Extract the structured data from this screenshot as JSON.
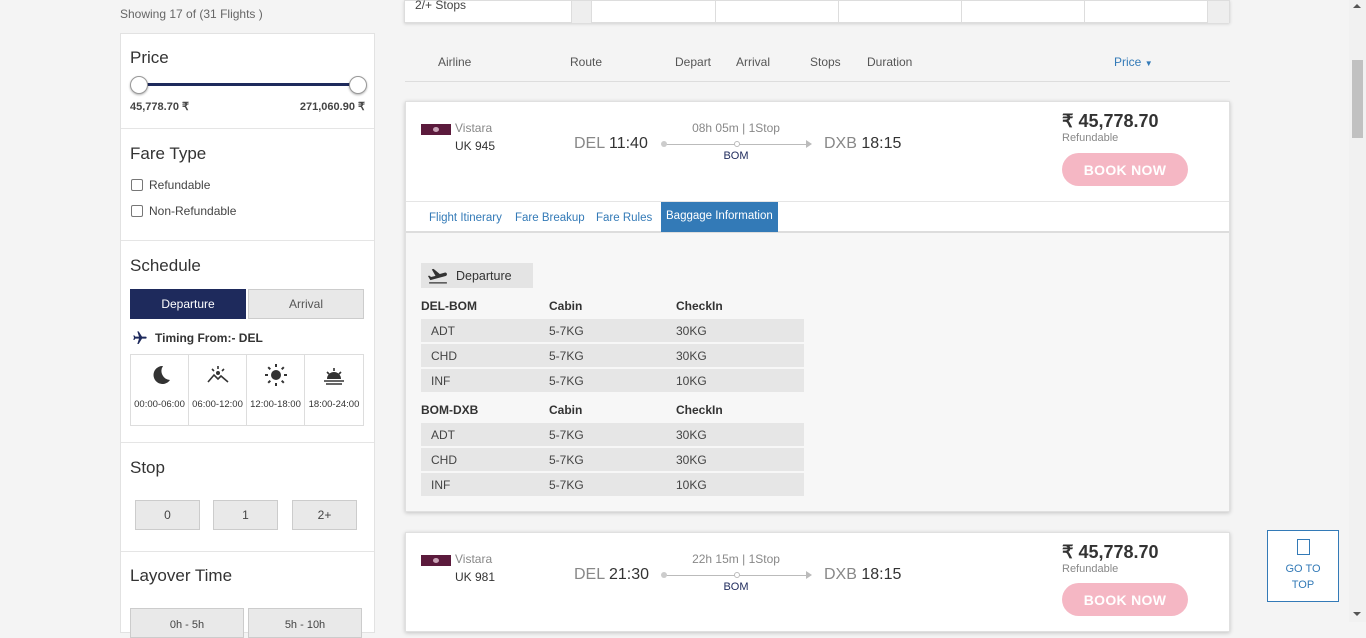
{
  "results": {
    "showing": "Showing 17 of (31 Flights )"
  },
  "top_strip": {
    "label": "2/+ Stops"
  },
  "filters": {
    "price": {
      "title": "Price",
      "min": "45,778.70 ₹",
      "max": "271,060.90 ₹"
    },
    "fare_type": {
      "title": "Fare Type",
      "options": [
        "Refundable",
        "Non-Refundable"
      ]
    },
    "schedule": {
      "title": "Schedule",
      "tabs": [
        "Departure",
        "Arrival"
      ],
      "timing": "Timing From:- DEL",
      "slots": [
        "00:00-06:00",
        "06:00-12:00",
        "12:00-18:00",
        "18:00-24:00"
      ]
    },
    "stop": {
      "title": "Stop",
      "options": [
        "0",
        "1",
        "2+"
      ]
    },
    "layover": {
      "title": "Layover Time",
      "options": [
        "0h - 5h",
        "5h - 10h"
      ]
    }
  },
  "columns": {
    "airline": "Airline",
    "route": "Route",
    "depart": "Depart",
    "arrival": "Arrival",
    "stops": "Stops",
    "duration": "Duration",
    "price": "Price"
  },
  "flights": [
    {
      "airline": "Vistara",
      "number": "UK  945",
      "dep_code": "DEL",
      "dep_time": "11:40",
      "duration": "08h 05m | 1Stop",
      "via": "BOM",
      "arr_code": "DXB",
      "arr_time": "18:15",
      "fare": "₹ 45,778.70",
      "refund": "Refundable",
      "book": "BOOK NOW",
      "tabs": [
        "Flight Itinerary",
        "Fare Breakup",
        "Fare Rules",
        "Baggage Information"
      ],
      "baggage": {
        "direction": "Departure",
        "legs": [
          {
            "leg": "DEL-BOM",
            "cabin_h": "Cabin",
            "checkin_h": "CheckIn",
            "rows": [
              [
                "ADT",
                "5-7KG",
                "30KG"
              ],
              [
                "CHD",
                "5-7KG",
                "30KG"
              ],
              [
                "INF",
                "5-7KG",
                "10KG"
              ]
            ]
          },
          {
            "leg": "BOM-DXB",
            "cabin_h": "Cabin",
            "checkin_h": "CheckIn",
            "rows": [
              [
                "ADT",
                "5-7KG",
                "30KG"
              ],
              [
                "CHD",
                "5-7KG",
                "30KG"
              ],
              [
                "INF",
                "5-7KG",
                "10KG"
              ]
            ]
          }
        ]
      }
    },
    {
      "airline": "Vistara",
      "number": "UK  981",
      "dep_code": "DEL",
      "dep_time": "21:30",
      "duration": "22h 15m | 1Stop",
      "via": "BOM",
      "arr_code": "DXB",
      "arr_time": "18:15",
      "fare": "₹ 45,778.70",
      "refund": "Refundable",
      "book": "BOOK NOW"
    }
  ],
  "go_to_top": {
    "line1": "GO TO",
    "line2": "TOP"
  }
}
